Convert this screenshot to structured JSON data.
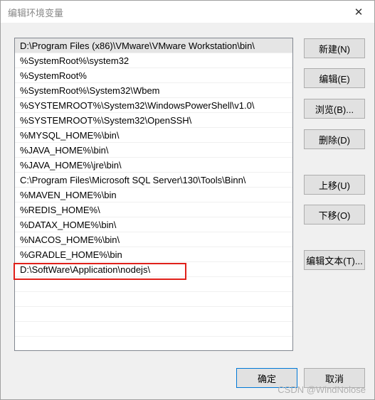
{
  "window": {
    "title": "编辑环境变量",
    "close_glyph": "✕"
  },
  "list": {
    "items": [
      "D:\\Program Files (x86)\\VMware\\VMware Workstation\\bin\\",
      "%SystemRoot%\\system32",
      "%SystemRoot%",
      "%SystemRoot%\\System32\\Wbem",
      "%SYSTEMROOT%\\System32\\WindowsPowerShell\\v1.0\\",
      "%SYSTEMROOT%\\System32\\OpenSSH\\",
      "%MYSQL_HOME%\\bin\\",
      "%JAVA_HOME%\\bin\\",
      "%JAVA_HOME%\\jre\\bin\\",
      "C:\\Program Files\\Microsoft SQL Server\\130\\Tools\\Binn\\",
      "%MAVEN_HOME%\\bin",
      "%REDIS_HOME%\\",
      "%DATAX_HOME%\\bin\\",
      "%NACOS_HOME%\\bin\\",
      "%GRADLE_HOME%\\bin",
      "D:\\SoftWare\\Application\\nodejs\\"
    ],
    "selected_index": 0,
    "highlight_color": "#e0201a"
  },
  "buttons": {
    "new": "新建(N)",
    "edit": "编辑(E)",
    "browse": "浏览(B)...",
    "delete": "删除(D)",
    "move_up": "上移(U)",
    "move_down": "下移(O)",
    "edit_text": "编辑文本(T)...",
    "ok": "确定",
    "cancel": "取消"
  },
  "watermark": "CSDN @WindNolose"
}
